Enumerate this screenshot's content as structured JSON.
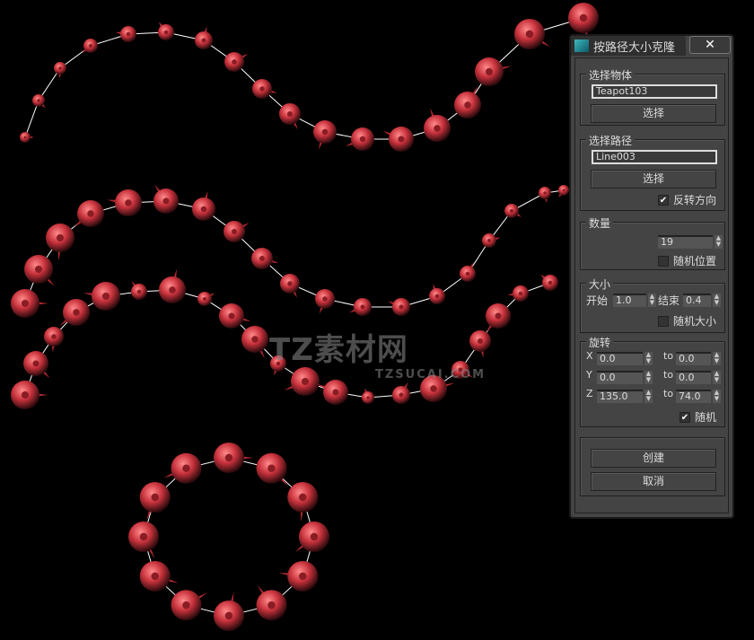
{
  "watermark": {
    "main": "TZ素材网",
    "sub": "TZSUCAI.COM"
  },
  "colors": {
    "bead": "#c8323c",
    "line": "#ffffff",
    "panel": "#444444"
  },
  "dialog": {
    "title": "按路径大小克隆",
    "close": "✕",
    "pick_object": {
      "label": "选择物体",
      "value": "Teapot103",
      "button": "选择"
    },
    "pick_path": {
      "label": "选择路径",
      "value": "Line003",
      "button": "选择",
      "reverse": {
        "label": "反转方向",
        "checked": true
      }
    },
    "count": {
      "label": "数量",
      "value": "19",
      "random_pos": {
        "label": "随机位置",
        "checked": false
      }
    },
    "size": {
      "label": "大小",
      "start_label": "开始",
      "start": "1.0",
      "end_label": "结束",
      "end": "0.4",
      "random_size": {
        "label": "随机大小",
        "checked": false
      }
    },
    "rotation": {
      "label": "旋转",
      "to": "to",
      "rows": [
        {
          "axis": "X",
          "from": "0.0",
          "to": "0.0"
        },
        {
          "axis": "Y",
          "from": "0.0",
          "to": "0.0"
        },
        {
          "axis": "Z",
          "from": "135.0",
          "to": "74.0"
        }
      ],
      "random": {
        "label": "随机",
        "checked": true
      }
    },
    "create": "创建",
    "cancel": "取消"
  }
}
